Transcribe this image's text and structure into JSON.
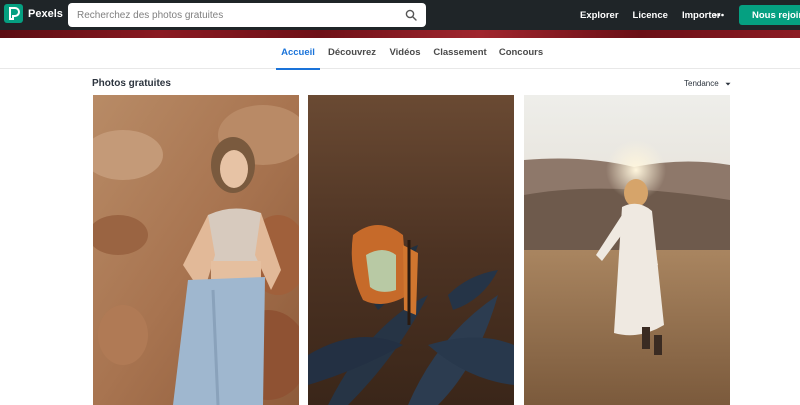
{
  "header": {
    "brand": "Pexels",
    "search_placeholder": "Recherchez des photos gratuites",
    "nav": [
      "Explorer",
      "Licence",
      "Importer"
    ],
    "join_label": "Nous rejoindre"
  },
  "tabs": [
    {
      "label": "Accueil",
      "active": true
    },
    {
      "label": "Découvrez",
      "active": false
    },
    {
      "label": "Vidéos",
      "active": false
    },
    {
      "label": "Classement",
      "active": false
    },
    {
      "label": "Concours",
      "active": false
    }
  ],
  "section": {
    "title": "Photos gratuites",
    "sort": "Tendance"
  },
  "colors": {
    "header_bg": "#1f2528",
    "brand_green": "#05a081",
    "active_tab": "#1a73d9"
  },
  "icons": {
    "logo": "pexels-logo-icon",
    "search": "search-icon",
    "more": "more-dots-icon",
    "sort": "chevron-down-icon"
  }
}
